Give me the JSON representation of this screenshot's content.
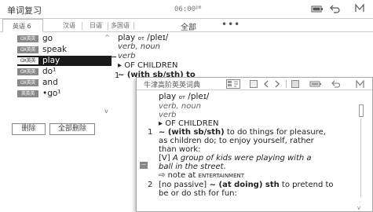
{
  "back_window": {
    "title": "单词复习",
    "clock": {
      "time": "06:00",
      "ampm": "pm"
    },
    "tabs": [
      {
        "label": "英语 6",
        "active": true
      },
      {
        "label": "汉语"
      },
      {
        "label": "日语"
      },
      {
        "label": "多国语"
      }
    ],
    "tab_all_label": "全部",
    "tab_more_label": "•••",
    "word_list": [
      {
        "badge": "OX英英",
        "word": "go"
      },
      {
        "badge": "OX英英",
        "word": "speak"
      },
      {
        "badge": "OX英英",
        "word": "play",
        "selected": true
      },
      {
        "badge": "OX英英",
        "word": "do¹"
      },
      {
        "badge": "OX英英",
        "word": "and"
      },
      {
        "badge": "英英英",
        "word": "•go¹"
      }
    ],
    "buttons": {
      "delete": "删除",
      "delete_all": "全部删除"
    },
    "preview": {
      "headword": "play",
      "mark": "ᴏᴛ",
      "pron": "/pleɪ/",
      "pos_line": "verb, noun",
      "pos2": "verb",
      "children": "▸ OF CHILDREN",
      "num": "1",
      "sense_start": "~ (with sb/sth) to"
    }
  },
  "popup": {
    "title": "牛津高阶英英词典",
    "headword": "play",
    "mark": "ᴏᴛ",
    "pron": "/pleɪ/",
    "pos_line": "verb, noun",
    "pos2": "verb",
    "children": "▸ OF CHILDREN",
    "sense1_num": "1",
    "sense1_pattern": "~ (with sb/sth)",
    "sense1_def_a": " to do things for pleasure,",
    "sense1_def_b": "as children do; to enjoy yourself, rather",
    "sense1_def_c": "than work:",
    "sense1_ex_label": "[V]",
    "sense1_ex_a": " A group of kids were playing with a",
    "sense1_ex_b": "ball in the street.",
    "note_arrow": "⇨",
    "note_text": " note at ",
    "note_ref": "ENTERTAINMENT",
    "sense2_num": "2",
    "sense2_label": "[no passive]",
    "sense2_pattern": " ~ (at doing) sth",
    "sense2_def_a": " to pretend to",
    "sense2_def_b": "be or do sth for fun:",
    "side_marker": "一"
  }
}
